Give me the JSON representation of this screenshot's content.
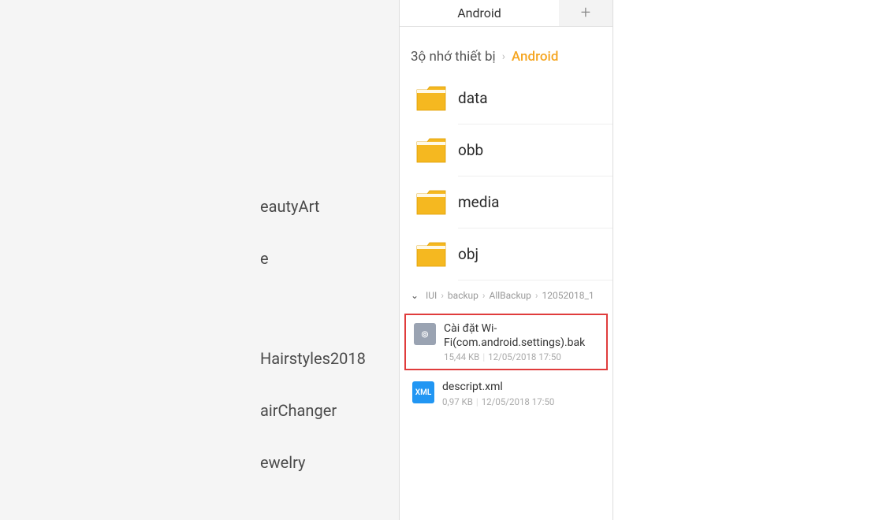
{
  "left_panel": {
    "items": [
      "eautyArt",
      "e",
      "Hairstyles2018",
      "airChanger",
      "ewelry"
    ]
  },
  "tabs": {
    "active_label": "Android",
    "add_label": "+"
  },
  "breadcrumb": {
    "parent": "3ộ nhớ thiết bị",
    "chev": "›",
    "current": "Android"
  },
  "folders": [
    {
      "name": "data"
    },
    {
      "name": "obb"
    },
    {
      "name": "media"
    },
    {
      "name": "obj"
    }
  ],
  "secondary_breadcrumb": {
    "expander_glyph": "⌄",
    "parts": [
      "IUI",
      "backup",
      "AllBackup",
      "12052018_1"
    ],
    "chev": "›"
  },
  "files": [
    {
      "name": "Cài đặt Wi-Fi(com.android.settings).bak",
      "size": "15,44 KB",
      "date": "12/05/2018 17:50",
      "icon_type": "bak",
      "icon_glyph": "◎",
      "highlighted": true
    },
    {
      "name": "descript.xml",
      "size": "0,97 KB",
      "date": "12/05/2018 17:50",
      "icon_type": "xml",
      "icon_glyph": "XML",
      "highlighted": false
    }
  ],
  "colors": {
    "accent": "#f5a623",
    "highlight_border": "#e03c3c"
  }
}
